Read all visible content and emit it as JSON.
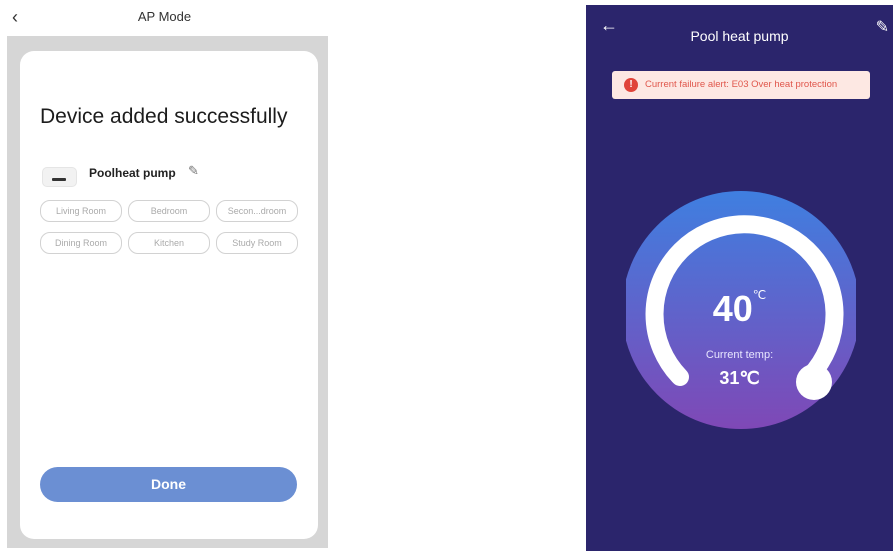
{
  "left": {
    "header": {
      "back_glyph": "‹",
      "title": "AP Mode"
    },
    "success_text": "Device added successfully",
    "device": {
      "name_bold": "Pool",
      "name_rest": "heat pump",
      "icon": "device-thumbnail"
    },
    "rooms": [
      "Living Room",
      "Bedroom",
      "Secon...droom",
      "Dining Room",
      "Kitchen",
      "Study Room"
    ],
    "done_label": "Done",
    "accent_color": "#6b8fd3"
  },
  "right": {
    "header": {
      "back_glyph": "←",
      "title": "Pool heat pump",
      "edit_icon": "edit-pencil-icon"
    },
    "alert": {
      "icon": "alert-exclamation-icon",
      "text": "Current failure alert: E03 Over heat protection"
    },
    "set_temp": "40",
    "set_unit": "℃",
    "current_label": "Current temp:",
    "current_value": "31℃",
    "background_color": "#2b256c"
  }
}
